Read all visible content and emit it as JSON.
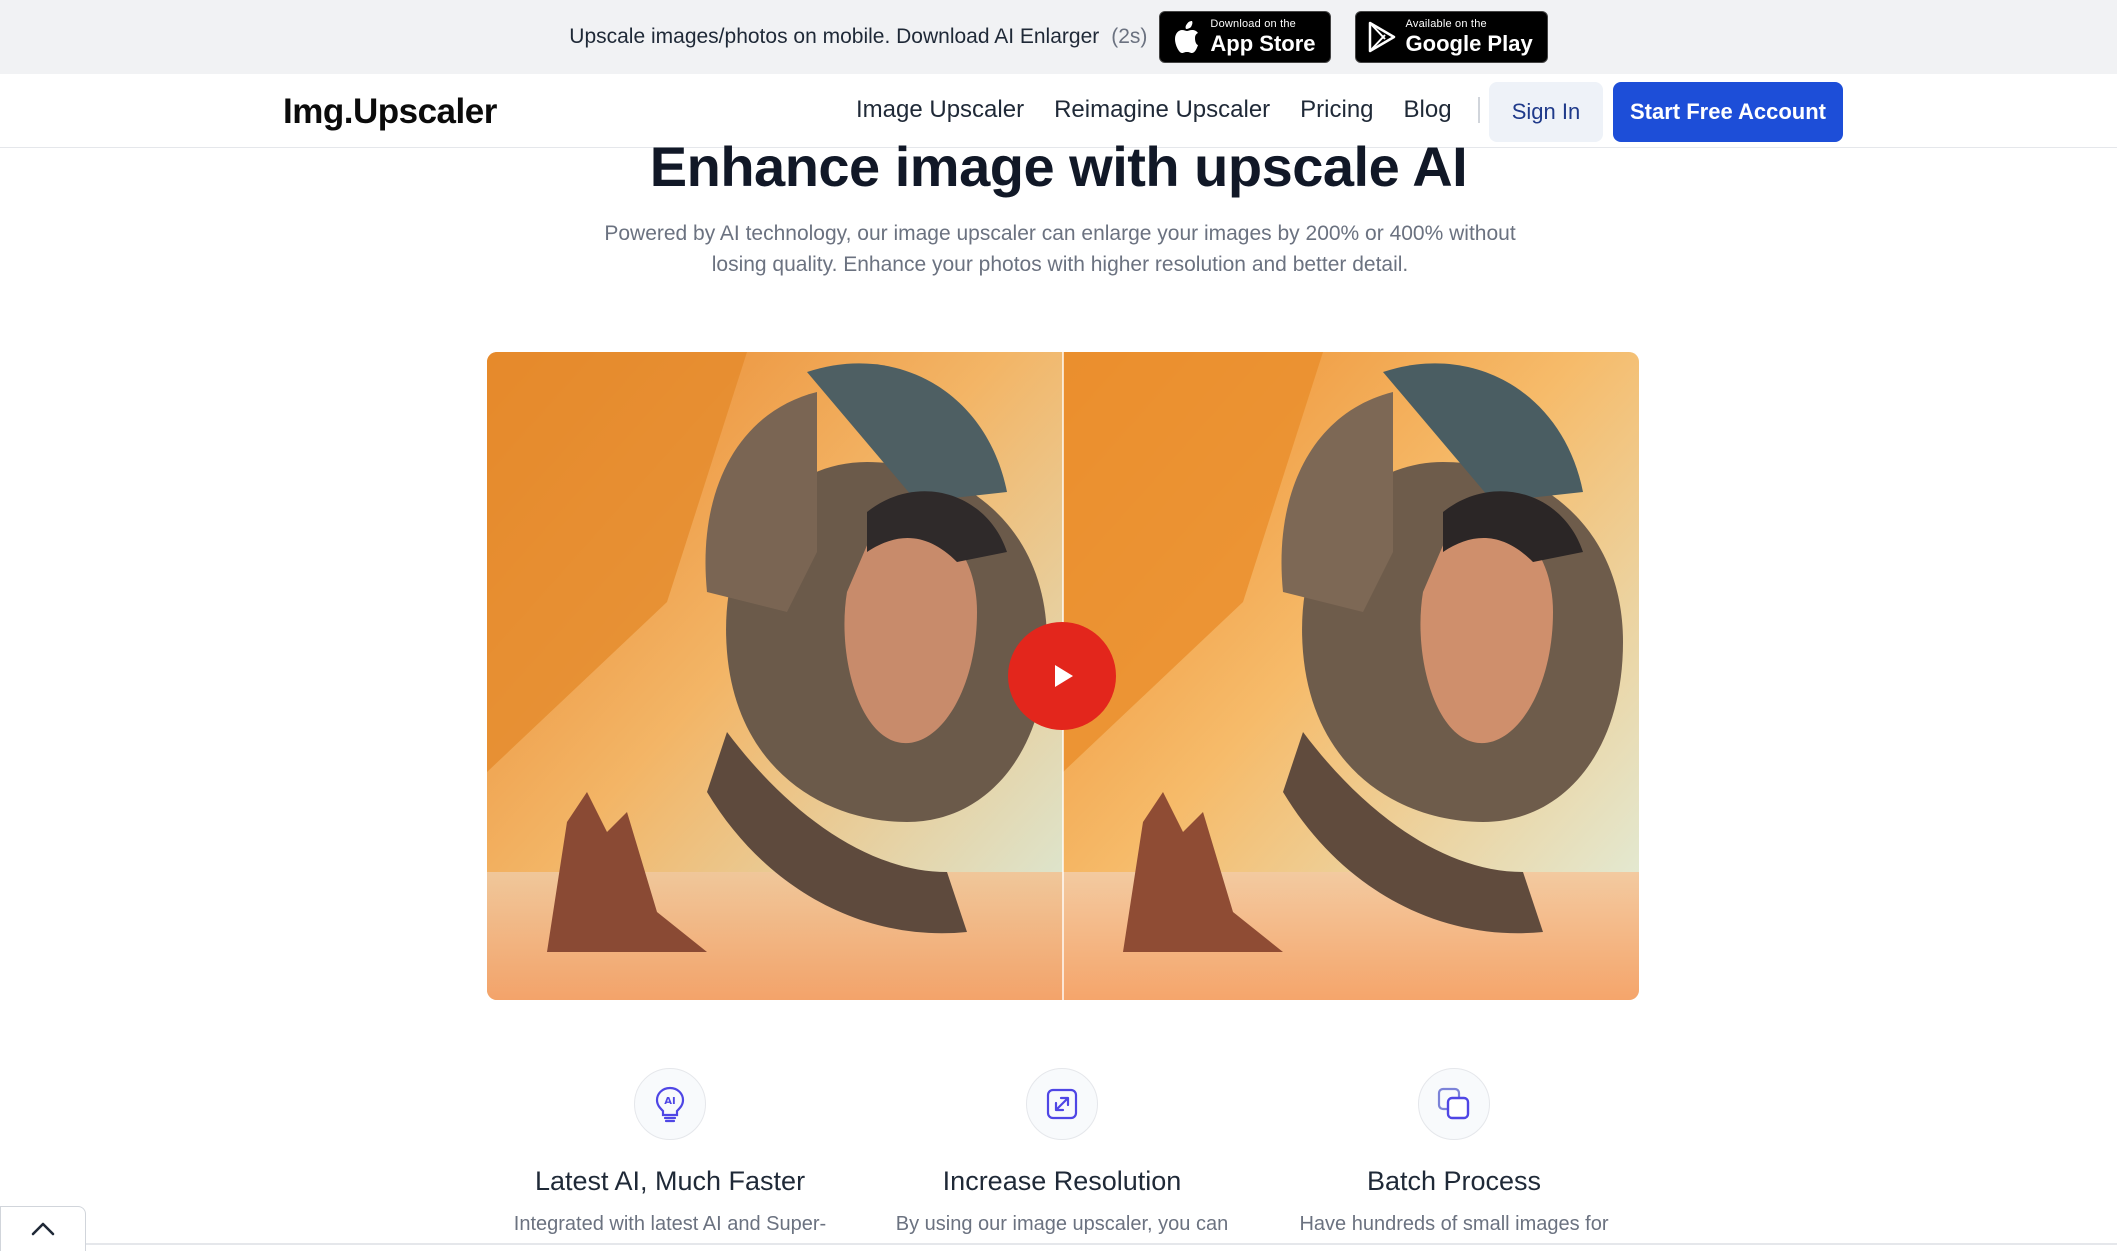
{
  "promo": {
    "text": "Upscale images/photos on mobile. Download AI Enlarger",
    "countdown": "(2s)",
    "app_store": {
      "small": "Download on the",
      "big": "App Store"
    },
    "google_play": {
      "small": "Available on the",
      "big": "Google Play"
    }
  },
  "nav": {
    "logo": "Img.Upscaler",
    "links": [
      "Image Upscaler",
      "Reimagine Upscaler",
      "Pricing",
      "Blog"
    ],
    "sign_in": "Sign In",
    "start": "Start Free Account"
  },
  "hero": {
    "title": "Enhance image with upscale AI",
    "subtitle": "Powered by AI technology, our image upscaler can enlarge your images by 200% or 400% without losing quality. Enhance your photos with higher resolution and better detail."
  },
  "features": [
    {
      "icon": "ai-bulb-icon",
      "title": "Latest AI, Much Faster",
      "desc": "Integrated with latest AI and Super-"
    },
    {
      "icon": "resize-arrow-icon",
      "title": "Increase Resolution",
      "desc": "By using our image upscaler, you can"
    },
    {
      "icon": "layers-icon",
      "title": "Batch Process",
      "desc": "Have hundreds of small images for"
    }
  ],
  "colors": {
    "primary": "#1d4ed8",
    "play": "#e3261c",
    "accent_icon": "#4f46e5"
  }
}
